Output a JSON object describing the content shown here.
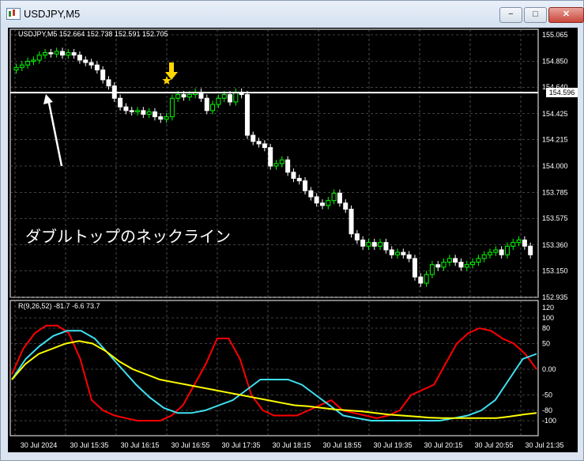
{
  "window": {
    "title": "USDJPY,M5",
    "minimize": "−",
    "maximize": "□",
    "close": "✕"
  },
  "chart": {
    "symbol_info": "USDJPY,M5  152.664 152.738 152.591 152.705",
    "indicator_info": "R(9,26,52) -81.7 -6.6 73.7",
    "annotation": "ダブルトップのネックライン",
    "neckline_price": "154.596",
    "price_ticks": [
      "155.065",
      "154.850",
      "154.640",
      "154.425",
      "154.215",
      "154.000",
      "153.785",
      "153.575",
      "153.360",
      "153.150",
      "152.935"
    ],
    "indicator_ticks": [
      "120",
      "100",
      "80",
      "50",
      "0.00",
      "-50",
      "-80",
      "-100"
    ],
    "time_ticks": [
      "30 Jul 2024",
      "30 Jul 15:35",
      "30 Jul 16:15",
      "30 Jul 16:55",
      "30 Jul 17:35",
      "30 Jul 18:15",
      "30 Jul 18:55",
      "30 Jul 19:35",
      "30 Jul 20:15",
      "30 Jul 20:55",
      "30 Jul 21:35"
    ],
    "colors": {
      "bull": "#00ff00",
      "bear": "#ffffff",
      "line_red": "#ff0000",
      "line_cyan": "#40e0f0",
      "line_yellow": "#ffff00",
      "marker": "#ffd700"
    }
  },
  "chart_data": [
    {
      "type": "candlestick",
      "y_range": [
        152.935,
        155.065
      ],
      "close_prices": [
        154.8,
        154.82,
        154.85,
        154.86,
        154.9,
        154.92,
        154.91,
        154.93,
        154.9,
        154.92,
        154.9,
        154.86,
        154.84,
        154.82,
        154.78,
        154.7,
        154.65,
        154.55,
        154.48,
        154.45,
        154.44,
        154.45,
        154.42,
        154.44,
        154.4,
        154.38,
        154.4,
        154.55,
        154.58,
        154.56,
        154.58,
        154.6,
        154.55,
        154.45,
        154.5,
        154.55,
        154.58,
        154.52,
        154.6,
        154.58,
        154.25,
        154.2,
        154.18,
        154.15,
        154.0,
        154.02,
        154.05,
        153.95,
        153.9,
        153.88,
        153.8,
        153.75,
        153.7,
        153.68,
        153.72,
        153.78,
        153.7,
        153.65,
        153.45,
        153.4,
        153.35,
        153.38,
        153.35,
        153.38,
        153.32,
        153.28,
        153.3,
        153.28,
        153.25,
        153.1,
        153.05,
        153.12,
        153.2,
        153.18,
        153.22,
        153.25,
        153.22,
        153.18,
        153.2,
        153.22,
        153.25,
        153.28,
        153.3,
        153.32,
        153.28,
        153.35,
        153.38,
        153.4,
        153.35,
        153.28
      ]
    },
    {
      "type": "line",
      "y_range": [
        -120,
        120
      ],
      "series": [
        {
          "values": [
            -10,
            40,
            70,
            85,
            85,
            70,
            20,
            -60,
            -80,
            -90,
            -95,
            -100,
            -100,
            -100,
            -90,
            -70,
            -30,
            10,
            60,
            60,
            20,
            -50,
            -80,
            -90,
            -90,
            -90,
            -80,
            -70,
            -60,
            -80,
            -85,
            -90,
            -95,
            -90,
            -80,
            -50,
            -40,
            -30,
            10,
            50,
            70,
            80,
            75,
            60,
            50,
            30,
            0
          ]
        },
        {
          "values": [
            -20,
            20,
            45,
            65,
            75,
            75,
            60,
            30,
            0,
            -30,
            -55,
            -75,
            -85,
            -85,
            -80,
            -70,
            -60,
            -40,
            -20,
            -20,
            -20,
            -30,
            -50,
            -70,
            -90,
            -95,
            -100,
            -100,
            -100,
            -100,
            -100,
            -100,
            -95,
            -90,
            -80,
            -60,
            -20,
            20,
            30
          ]
        },
        {
          "values": [
            -20,
            10,
            30,
            40,
            50,
            55,
            50,
            35,
            15,
            0,
            -10,
            -20,
            -25,
            -30,
            -35,
            -40,
            -45,
            -50,
            -55,
            -60,
            -65,
            -70,
            -72,
            -75,
            -78,
            -80,
            -82,
            -85,
            -88,
            -90,
            -92,
            -94,
            -95,
            -95,
            -95,
            -95,
            -95,
            -92,
            -88,
            -85
          ]
        }
      ]
    }
  ]
}
